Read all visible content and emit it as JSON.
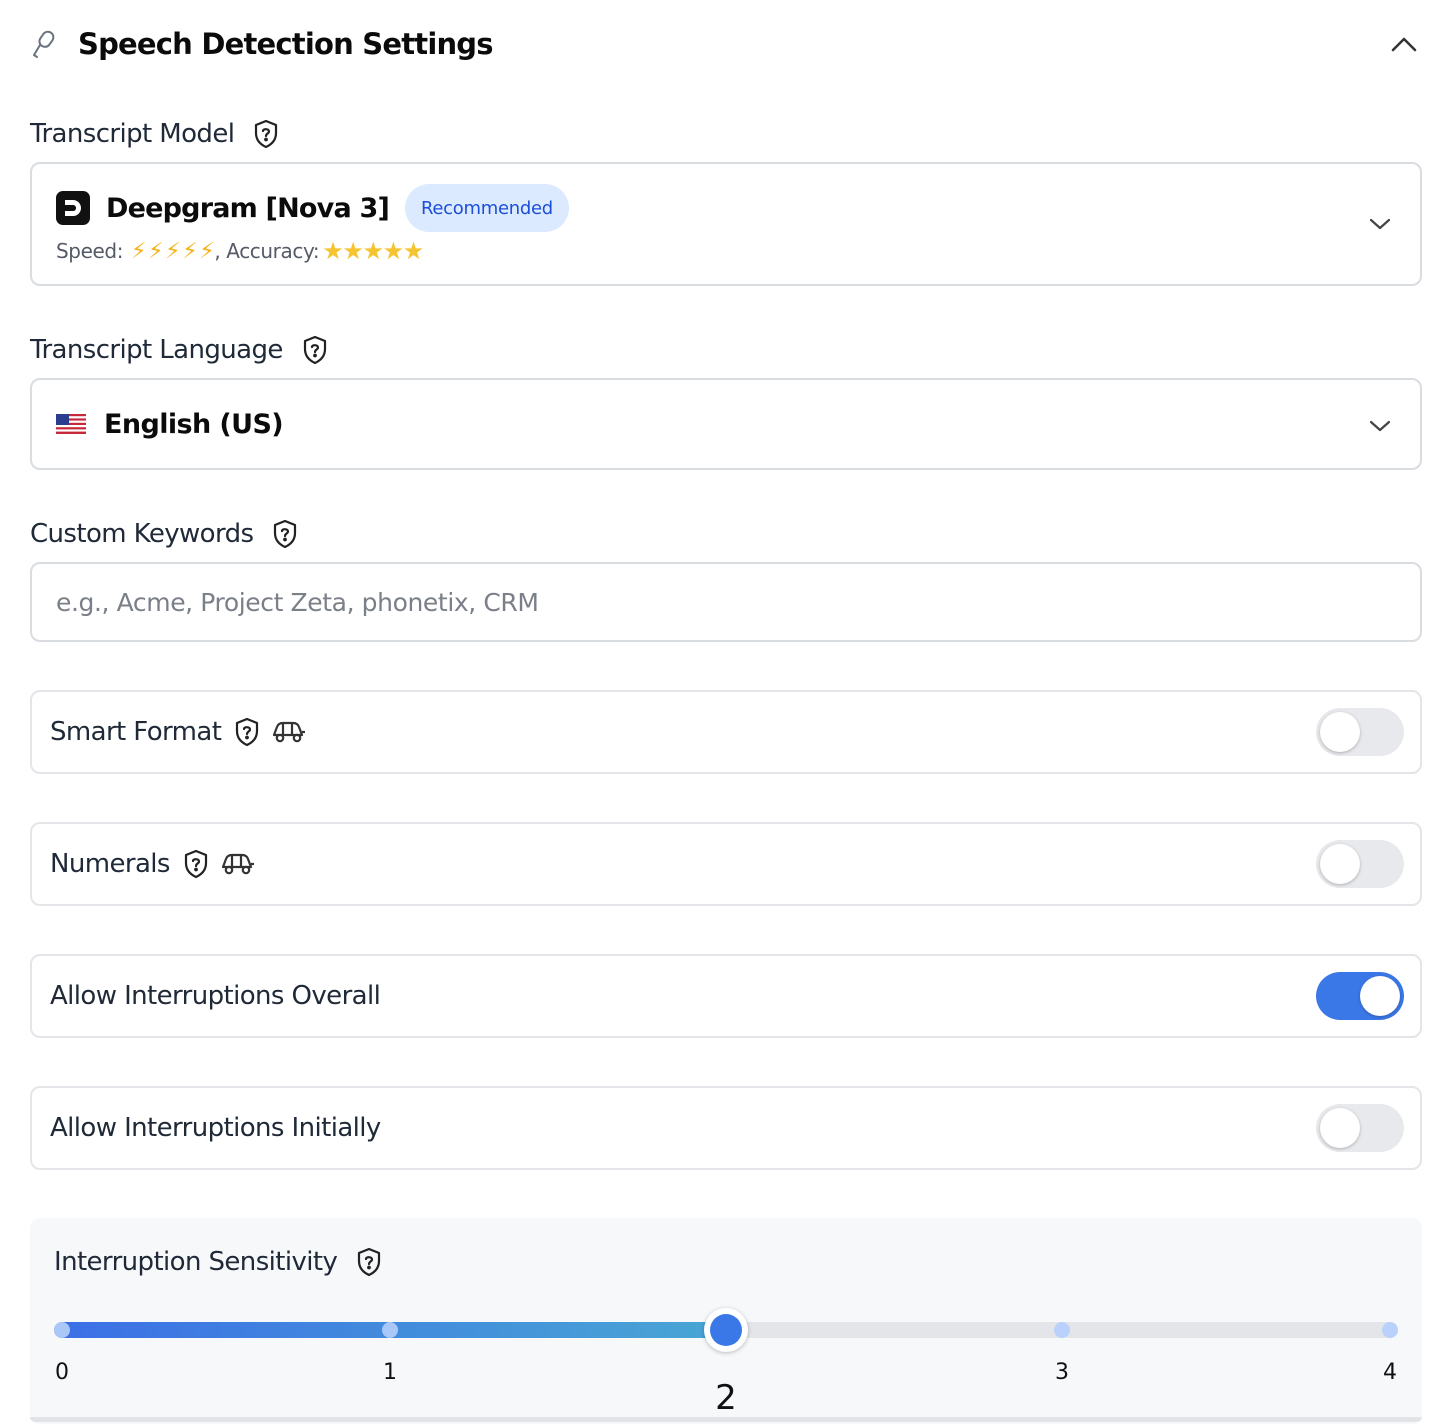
{
  "header": {
    "title": "Speech Detection Settings"
  },
  "transcript_model": {
    "label": "Transcript Model",
    "selected": "Deepgram [Nova 3]",
    "badge": "Recommended",
    "speed_label": "Speed:",
    "speed_rating": 5,
    "accuracy_label": ", Accuracy:",
    "accuracy_rating": 5
  },
  "transcript_language": {
    "label": "Transcript Language",
    "selected": "English (US)",
    "flag_icon": "us-flag-icon"
  },
  "custom_keywords": {
    "label": "Custom Keywords",
    "value": "",
    "placeholder": "e.g., Acme, Project Zeta, phonetix, CRM"
  },
  "toggles": [
    {
      "label": "Smart Format",
      "on": false,
      "has_help": true,
      "has_car_icon": true
    },
    {
      "label": "Numerals",
      "on": false,
      "has_help": true,
      "has_car_icon": true
    },
    {
      "label": "Allow Interruptions Overall",
      "on": true,
      "has_help": false,
      "has_car_icon": false
    },
    {
      "label": "Allow Interruptions Initially",
      "on": false,
      "has_help": false,
      "has_car_icon": false
    }
  ],
  "interruption_sensitivity": {
    "label": "Interruption Sensitivity",
    "min": 0,
    "max": 4,
    "value": 2,
    "ticks": [
      "0",
      "1",
      "2",
      "3",
      "4"
    ]
  },
  "colors": {
    "accent": "#3b78e7",
    "badge_bg": "#dbeafe",
    "badge_text": "#1d4ed8",
    "bolt": "#f6b21c",
    "star": "#f6c431"
  }
}
